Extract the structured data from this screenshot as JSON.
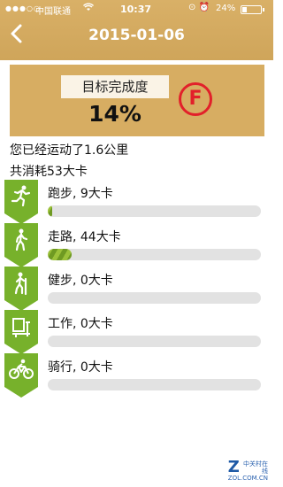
{
  "status_bar": {
    "signal": "●●●○○",
    "carrier": "中国联通",
    "time": "10:37",
    "battery_percent": "24%",
    "battery_level": 0.24
  },
  "header": {
    "back_icon": "chevron-left-icon",
    "title": "2015-01-06"
  },
  "goal": {
    "label": "目标完成度",
    "percent": "14%",
    "grade": "F",
    "grade_color": "#e2202a"
  },
  "summary": {
    "distance_text": "您已经运动了1.6公里",
    "calories_text": "共消耗53大卡"
  },
  "activities": [
    {
      "label": "跑步, 9大卡",
      "icon": "running-icon",
      "progress": 0.02
    },
    {
      "label": "走路, 44大卡",
      "icon": "walking-icon",
      "progress": 0.11
    },
    {
      "label": "健步, 0大卡",
      "icon": "hiking-icon",
      "progress": 0
    },
    {
      "label": "工作, 0大卡",
      "icon": "work-desk-icon",
      "progress": 0
    },
    {
      "label": "骑行, 0大卡",
      "icon": "cycling-icon",
      "progress": 0
    }
  ],
  "colors": {
    "header_bg": "#d9b067",
    "badge_green": "#77b12b",
    "bar_green": "#9cc23a",
    "track_gray": "#e2e2e2"
  },
  "watermark": {
    "line1": "中关村在线",
    "line2": "ZOL.COM.CN"
  }
}
